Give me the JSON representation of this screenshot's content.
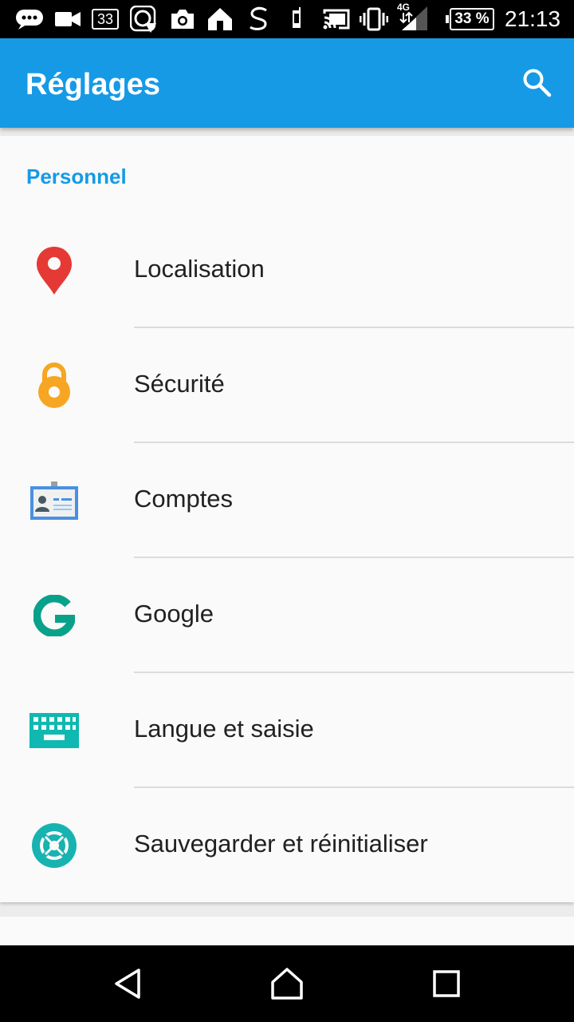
{
  "status_bar": {
    "sim_badge": "33",
    "network": "4G",
    "battery": "33 %",
    "time": "21:13"
  },
  "app_bar": {
    "title": "Réglages",
    "search_icon": "search-icon",
    "color": "#169ae6"
  },
  "section": {
    "title": "Personnel"
  },
  "items": [
    {
      "label": "Localisation",
      "icon": "location-pin-icon"
    },
    {
      "label": "Sécurité",
      "icon": "lock-icon"
    },
    {
      "label": "Comptes",
      "icon": "account-card-icon"
    },
    {
      "label": "Google",
      "icon": "google-icon"
    },
    {
      "label": "Langue et saisie",
      "icon": "keyboard-icon"
    },
    {
      "label": "Sauvegarder et réinitialiser",
      "icon": "backup-restore-icon"
    }
  ],
  "nav_bar": {
    "back_icon": "back-icon",
    "home_icon": "home-icon",
    "recents_icon": "recents-icon"
  }
}
